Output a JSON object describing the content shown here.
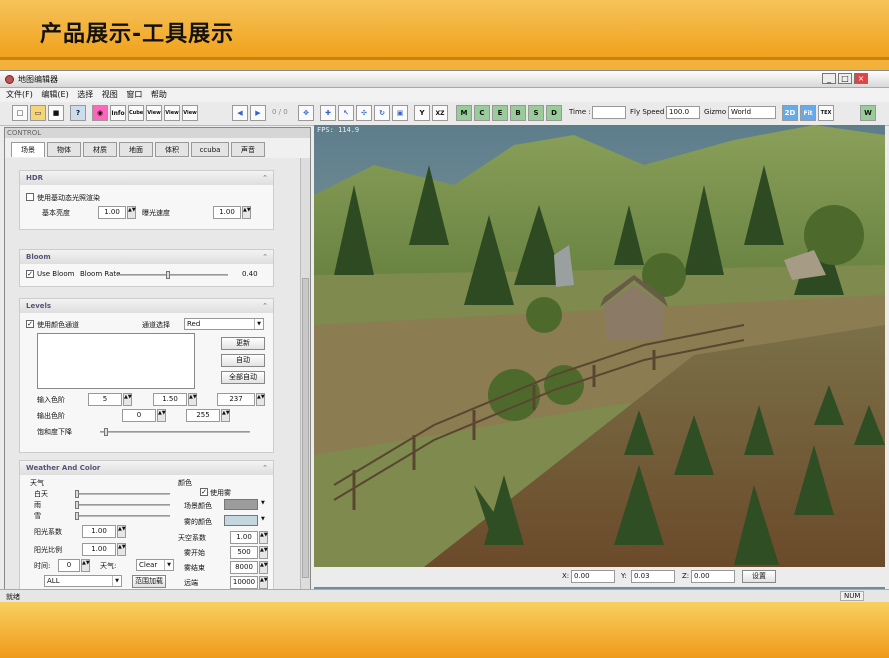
{
  "slide": {
    "title": "产品展示-工具展示"
  },
  "window": {
    "title": "地图编辑器",
    "controls": [
      "_",
      "□",
      "×"
    ]
  },
  "menu": [
    "文件(F)",
    "编辑(E)",
    "选择",
    "视图",
    "窗口",
    "帮助"
  ],
  "toolbar": {
    "icon_labels": [
      "Info",
      "Cube",
      "View",
      "View",
      "View"
    ],
    "frame_counter": "0 / 0",
    "axis_buttons": [
      "Y",
      "XZ"
    ],
    "mode_buttons": [
      "M",
      "C",
      "E",
      "B",
      "S",
      "D"
    ],
    "time_label": "Time :",
    "time_value": "",
    "flyspeed_label": "Fly Speed :",
    "flyspeed_value": "100.0",
    "gizmo_label": "Gizmo :",
    "gizmo_value": "World",
    "view_buttons": [
      "2D",
      "Fit",
      "TEX"
    ],
    "w_button": "W"
  },
  "panel": {
    "header": "CONTROL",
    "tabs": [
      "场景",
      "物体",
      "材质",
      "地面",
      "体积",
      "ccuba",
      "声音"
    ],
    "hdr": {
      "title": "HDR",
      "dynamic_label": "使用基动态光照渲染",
      "base_brightness_label": "基本亮度",
      "base_brightness": "1.00",
      "exposure_label": "曝光速度",
      "exposure": "1.00"
    },
    "bloom": {
      "title": "Bloom",
      "use_label": "Use Bloom",
      "rate_label": "Bloom Rate",
      "rate_value": "0.40",
      "rate_fraction": 0.45
    },
    "levels": {
      "title": "Levels",
      "channel_enable_label": "使用颜色通道",
      "channel_select_label": "通道选择",
      "channel_value": "Red",
      "update_btn": "更新",
      "auto_btn": "自动",
      "auto_all_btn": "全部自动",
      "input_label": "输入色阶",
      "input_values": [
        "5",
        "1.50",
        "237"
      ],
      "output_label": "输出色阶",
      "output_values": [
        "0",
        "255"
      ],
      "saturation_label": "饱和度下降"
    },
    "weather": {
      "title": "Weather And Color",
      "weather_label": "天气",
      "day_label": "白天",
      "rain_label": "雨",
      "snow_label": "雪",
      "sun_factor_label": "阳光系数",
      "sun_factor": "1.00",
      "sun_ratio_label": "阳光比例",
      "sun_ratio": "1.00",
      "time_label": "时间:",
      "time_value": "0",
      "weather2_label": "天气:",
      "weather_value": "Clear",
      "all_value": "ALL",
      "range_btn": "范围加载",
      "color_label": "颜色",
      "use_fog_label": "使用雾",
      "scene_color_label": "场景颜色",
      "fog_color_label": "雾的颜色",
      "sky_factor_label": "天空系数",
      "sky_factor": "1.00",
      "fog_start_label": "雾开始",
      "fog_start": "500",
      "fog_end_label": "雾结束",
      "fog_end": "8000",
      "far_label": "远端",
      "far_value": "10000"
    }
  },
  "viewport": {
    "fps": "FPS: 114.9"
  },
  "coords": {
    "x_label": "X:",
    "x": "0.00",
    "y_label": "Y:",
    "y": "0.03",
    "z_label": "Z:",
    "z": "0.00",
    "set_btn": "设置"
  },
  "statusbar": {
    "text": "就绪",
    "num": "NUM"
  },
  "colors": {
    "accent": "#f0a21c",
    "panel": "#f0f0f0",
    "group_title": "#557799"
  }
}
